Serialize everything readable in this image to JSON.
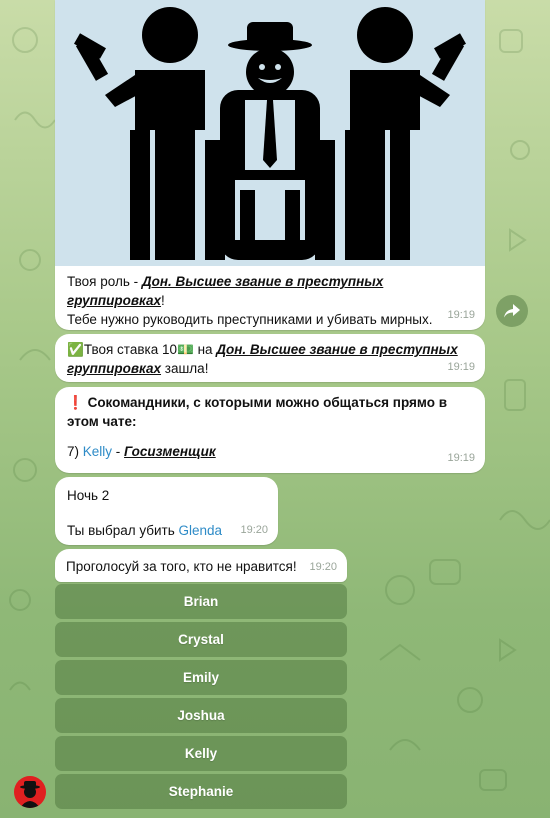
{
  "messages": {
    "role": {
      "prefix": "Твоя роль - ",
      "role": "Дон. Высшее звание в преступных группировках",
      "suffix": "!",
      "line2": "Тебе нужно руководить преступниками и убивать мирных.",
      "time": "19:19"
    },
    "bet": {
      "check": "✅",
      "text1": "Твоя ставка 10",
      "money": "💵",
      "text2": " на ",
      "role": "Дон. Высшее звание в преступных группировках",
      "text3": " зашла!",
      "time": "19:19"
    },
    "team": {
      "mark": "❗",
      "text": " Сокомандники, с которыми можно общаться прямо в этом чате:",
      "num": "7) ",
      "name": "Kelly",
      "dash": " - ",
      "role": "Госизменщик",
      "time": "19:19"
    },
    "night": {
      "title": "Ночь 2",
      "text": "Ты выбрал убить ",
      "target": "Glenda",
      "time": "19:20"
    },
    "vote": {
      "text": "Проголосуй за того, кто не нравится!",
      "time": "19:20"
    }
  },
  "keyboard": [
    "Brian",
    "Crystal",
    "Emily",
    "Joshua",
    "Kelly",
    "Stephanie"
  ],
  "icons": {
    "share": "share-arrow-icon",
    "avatar": "mafia-avatar"
  },
  "colors": {
    "link": "#2e8bc7",
    "button": "#6e8f5a"
  }
}
